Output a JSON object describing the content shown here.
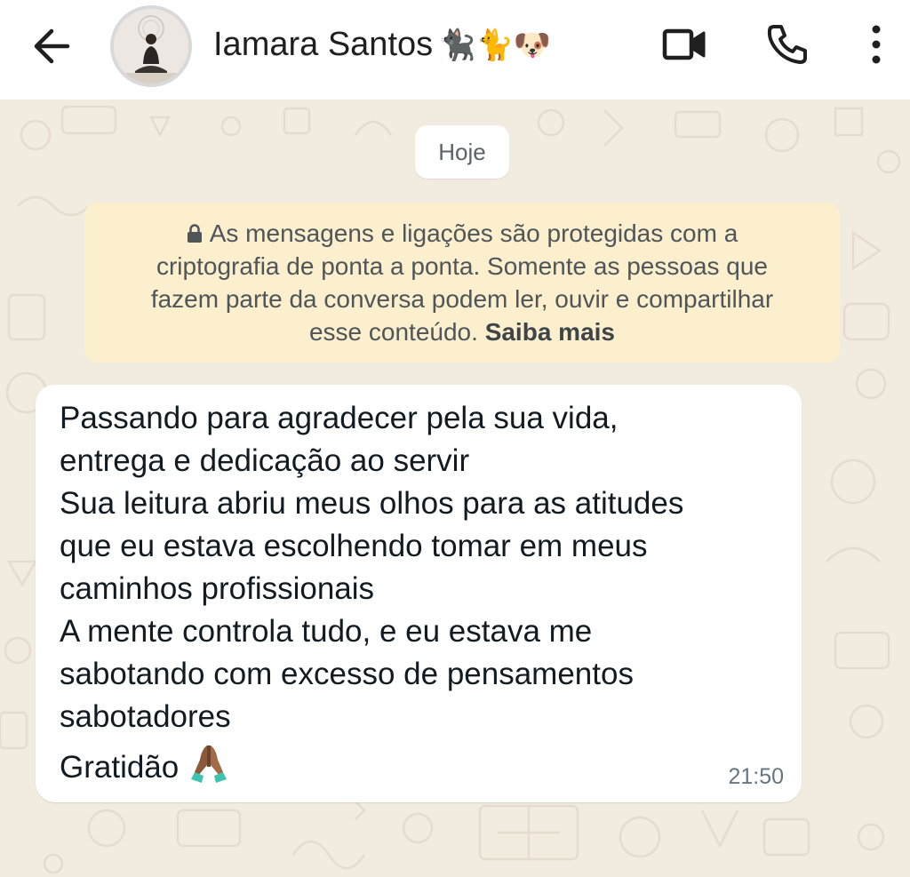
{
  "header": {
    "back_icon": "arrow-left-icon",
    "avatar_icon": "avatar",
    "contact_name": "Iamara Santos",
    "name_emojis": "🐈‍⬛🐈🐶",
    "video_icon": "video-camera-icon",
    "call_icon": "phone-icon",
    "menu_icon": "more-vertical-icon"
  },
  "chat": {
    "date_label": "Hoje",
    "encryption_notice": {
      "line1": "As mensagens e ligações são protegidas com a",
      "line2": "criptografia de ponta a ponta. Somente as pessoas que",
      "line3": "fazem parte da conversa podem ler, ouvir e compartilhar",
      "line4_prefix": "esse conteúdo.",
      "learn_more": "Saiba mais"
    },
    "message": {
      "lines": [
        "Passando para agradecer pela sua vida,",
        "entrega e dedicação ao servir",
        "Sua leitura abriu meus olhos para as atitudes",
        "que eu estava escolhendo tomar em meus",
        "caminhos profissionais",
        "A mente controla tudo, e eu estava me",
        "sabotando com excesso de pensamentos",
        "sabotadores"
      ],
      "closing": "Gratidão",
      "emoji_icon": "praying-hands-icon",
      "time": "21:50"
    }
  },
  "colors": {
    "chat_background": "#f1ebe0",
    "notice_background": "#fcefcd",
    "bubble_background": "#ffffff",
    "header_background": "#ffffff"
  }
}
